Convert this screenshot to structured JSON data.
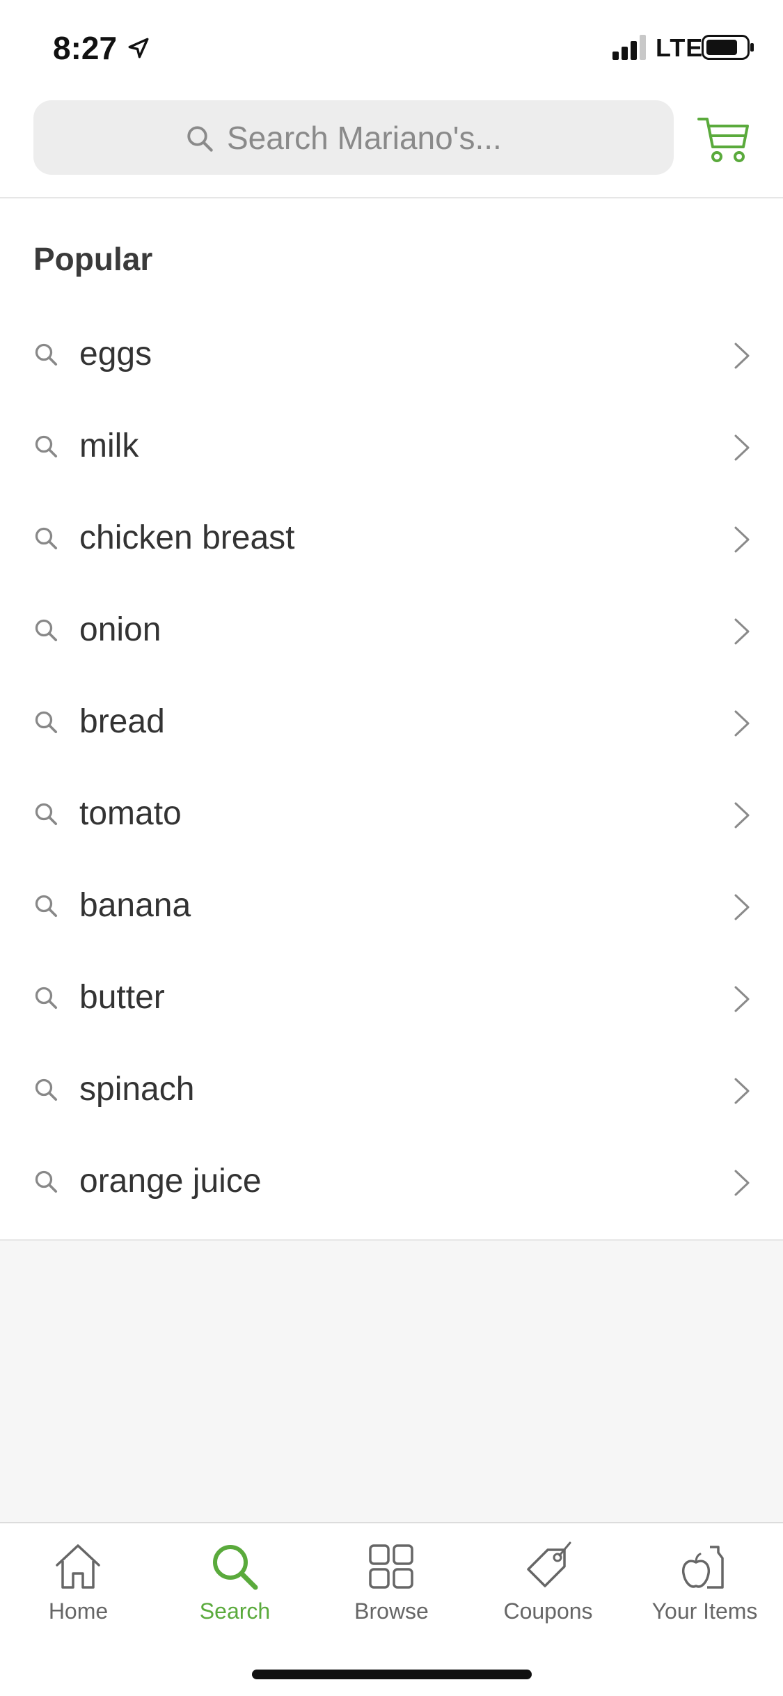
{
  "status_bar": {
    "time": "8:27",
    "network": "LTE"
  },
  "header": {
    "search_placeholder": "Search Mariano's...",
    "cart_icon": "cart-icon"
  },
  "popular": {
    "title": "Popular",
    "items": [
      {
        "label": "eggs"
      },
      {
        "label": "milk"
      },
      {
        "label": "chicken breast"
      },
      {
        "label": "onion"
      },
      {
        "label": "bread"
      },
      {
        "label": "tomato"
      },
      {
        "label": "banana"
      },
      {
        "label": "butter"
      },
      {
        "label": "spinach"
      },
      {
        "label": "orange juice"
      }
    ]
  },
  "tabs": [
    {
      "label": "Home",
      "icon": "home-icon",
      "active": false
    },
    {
      "label": "Search",
      "icon": "search-icon",
      "active": true
    },
    {
      "label": "Browse",
      "icon": "grid-icon",
      "active": false
    },
    {
      "label": "Coupons",
      "icon": "tag-icon",
      "active": false
    },
    {
      "label": "Your Items",
      "icon": "apple-bottle-icon",
      "active": false
    }
  ],
  "colors": {
    "accent": "#5aaa3c",
    "text": "#333333",
    "muted": "#888888"
  }
}
